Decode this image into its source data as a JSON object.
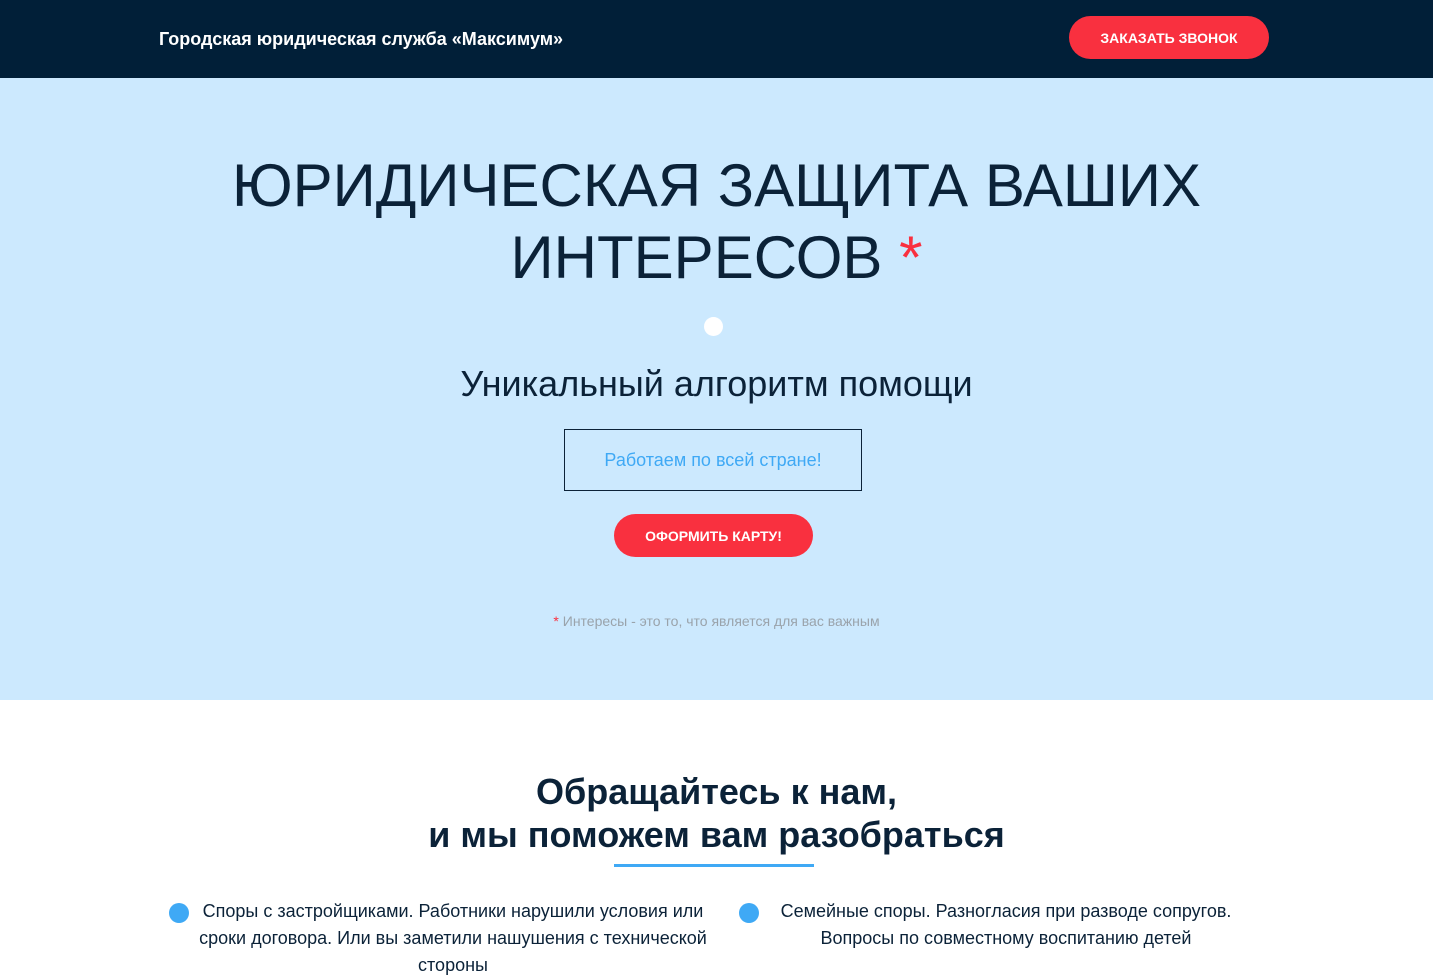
{
  "header": {
    "brand": "Городская юридическая служба «Максимум»",
    "call_button": "ЗАКАЗАТЬ ЗВОНОК"
  },
  "hero": {
    "title_line1": "ЮРИДИЧЕСКАЯ ЗАЩИТА ВАШИХ",
    "title_line2": "ИНТЕРЕСОВ",
    "title_star": "*",
    "subtitle": "Уникальный алгоритм помощи",
    "outline_box": "Работаем по всей стране!",
    "card_button": "ОФОРМИТЬ КАРТУ!",
    "footnote_star": "*",
    "footnote": "Интересы - это то, что является для вас важным"
  },
  "services": {
    "title_line1": "Обращайтесь к нам,",
    "title_line2": "и мы поможем вам разобраться",
    "items": [
      {
        "text": "Споры с застройщиками. Работники нарушили условия или сроки договора. Или вы заметили нашушения с технической стороны"
      },
      {
        "text": "Семейные споры. Разногласия при разводе сопругов. Вопросы по совместному воспитанию детей"
      }
    ]
  },
  "colors": {
    "header_bg": "#011f38",
    "hero_bg": "#cce9fe",
    "accent_red": "#f9303f",
    "accent_blue": "#3fa9f5",
    "text_dark": "#0b2238"
  }
}
